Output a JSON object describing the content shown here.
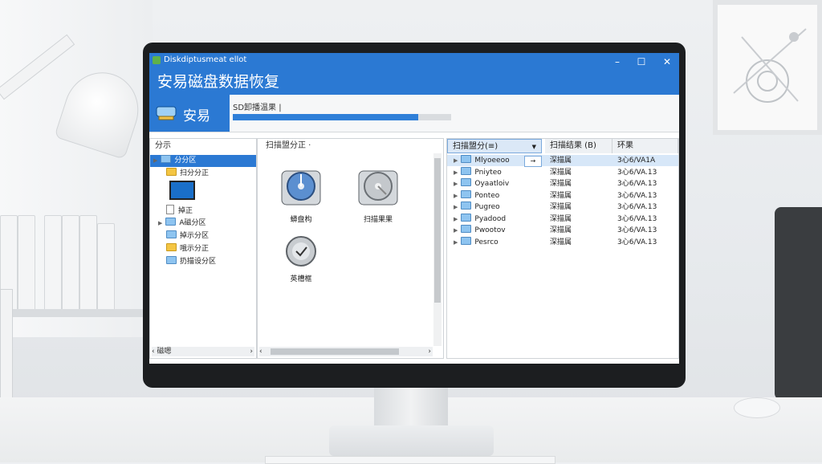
{
  "window": {
    "caption": "Diskdiptusmeat ellot",
    "app_title": "安易磁盘数据恢复",
    "controls": {
      "minimize": "–",
      "maximize": "☐",
      "close": "✕"
    }
  },
  "brand": {
    "name": "安易"
  },
  "progress": {
    "label": "SD卸播温果 |",
    "fraction": 0.85
  },
  "left_pane": {
    "header": "分示",
    "items": [
      {
        "label": "分分区",
        "icon": "folder-blue",
        "selected": true
      },
      {
        "label": "扫分分正",
        "icon": "folder-yellow"
      },
      {
        "label": "",
        "icon": "monitor"
      },
      {
        "label": "掉正",
        "icon": "page"
      },
      {
        "label": "A磁分区",
        "icon": "folder-blue"
      },
      {
        "label": "掉示分区",
        "icon": "folder-blue"
      },
      {
        "label": "哦示分正",
        "icon": "folder-yellow"
      },
      {
        "label": "扔描设分区",
        "icon": "folder-blue"
      }
    ],
    "scroll_label": "磁嗯"
  },
  "middle_pane": {
    "header": "扫描盟分正 ·",
    "disks": [
      {
        "label": "蟒盘构"
      },
      {
        "label": "扫描果果"
      },
      {
        "label": "英槽框"
      }
    ]
  },
  "right_pane": {
    "columns": [
      "扫描盟分(≡)",
      "扫描结果 (B)",
      "环果"
    ],
    "rows": [
      {
        "name": "Mlyoeeoo",
        "status": "深描属",
        "date": "3心6/VA1A",
        "selected": true
      },
      {
        "name": "Pniyteo",
        "status": "深描属",
        "date": "3心6/VA.13"
      },
      {
        "name": "Oyaatloiv",
        "status": "深描属",
        "date": "3心6/VA.13"
      },
      {
        "name": "Ponteo",
        "status": "深描属",
        "date": "3心6/VA.13"
      },
      {
        "name": "Pugreo",
        "status": "深描属",
        "date": "3心6/VA.13"
      },
      {
        "name": "Pyadood",
        "status": "深描属",
        "date": "3心6/VA.13"
      },
      {
        "name": "Pwootov",
        "status": "深描属",
        "date": "3心6/VA.13"
      },
      {
        "name": "Pesrco",
        "status": "深描属",
        "date": "3心6/VA.13"
      }
    ]
  }
}
